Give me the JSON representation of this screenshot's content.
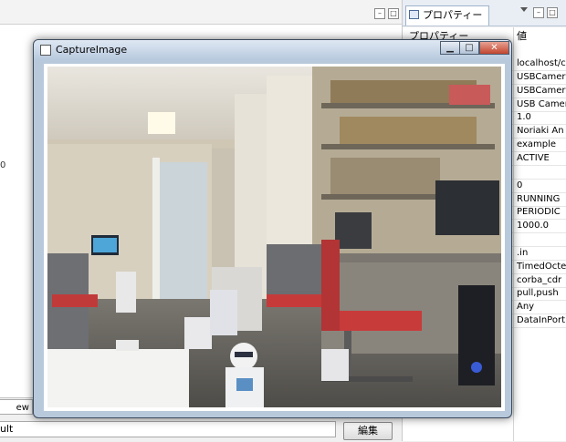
{
  "left_panel": {
    "digit": "0",
    "bottom_tab_label": "ew",
    "value_field": "ult",
    "edit_button_label": "編集"
  },
  "properties": {
    "tab_label": "プロパティー",
    "col_property": "プロパティー",
    "col_value": "値",
    "values": [
      "localhost/c",
      "USBCamer",
      "USBCamer",
      "USB Camer",
      "1.0",
      "Noriaki An",
      "example",
      "ACTIVE",
      "",
      "0",
      "RUNNING",
      "PERIODIC",
      "1000.0",
      "",
      ".in",
      "TimedOcte",
      "corba_cdr",
      "pull,push",
      "Any",
      "DataInPort"
    ]
  },
  "window": {
    "title": "CaptureImage"
  }
}
